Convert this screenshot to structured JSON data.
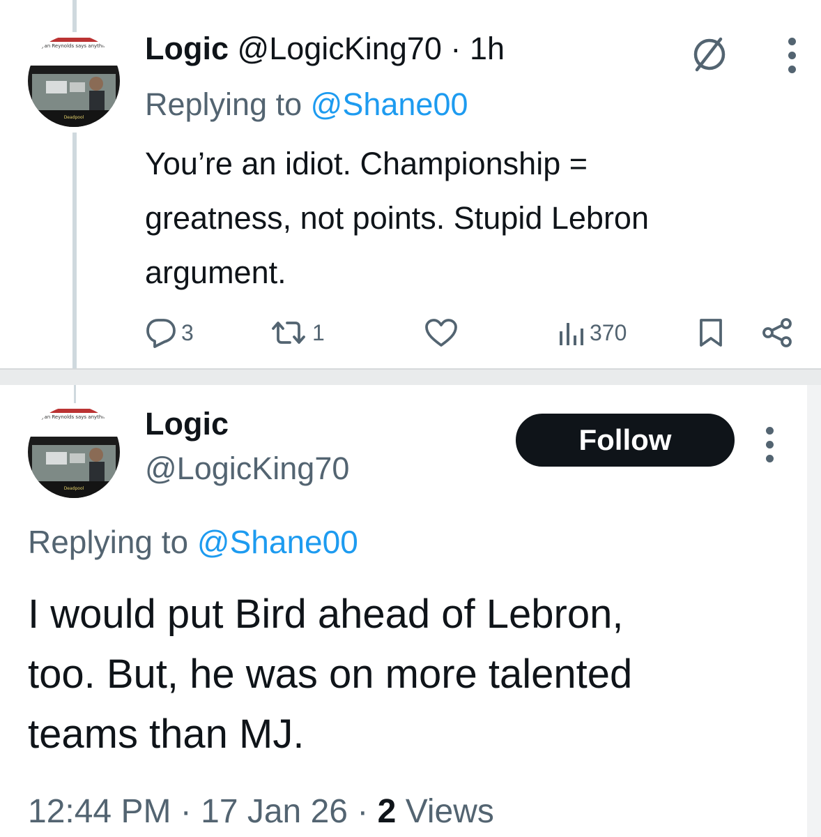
{
  "tweet1": {
    "display_name": "Logic",
    "handle": "@LogicKing70",
    "separator": "·",
    "time": "1h",
    "replying_prefix": "Replying to",
    "replying_to": "@Shane00",
    "text": "You’re an idiot. Championship =\ngreatness, not points. Stupid Lebron\nargument.",
    "avatar_caption": "Ryan Reynolds says anything",
    "stats": {
      "replies": "3",
      "reposts": "1",
      "likes": "",
      "views": "370"
    },
    "icons": [
      "grok-icon",
      "more-icon",
      "reply-icon",
      "repost-icon",
      "like-icon",
      "views-icon",
      "bookmark-icon",
      "share-icon"
    ]
  },
  "tweet2": {
    "display_name": "Logic",
    "handle": "@LogicKing70",
    "follow_label": "Follow",
    "replying_prefix": "Replying to",
    "replying_to": "@Shane00",
    "text": "I would put Bird ahead of Lebron,\ntoo. But, he was on more talented\nteams than MJ.",
    "time": "12:44 PM",
    "separator1": "·",
    "date": "17 Jan 26",
    "separator2": "·",
    "views_count": "2",
    "views_label": "Views",
    "avatar_caption": "Ryan Reynolds says anything"
  },
  "colors": {
    "text": "#0f1419",
    "muted": "#536471",
    "link": "#1d9bf0",
    "button_bg": "#0f1419",
    "button_text": "#ffffff",
    "thread_line": "#cfd9de"
  }
}
